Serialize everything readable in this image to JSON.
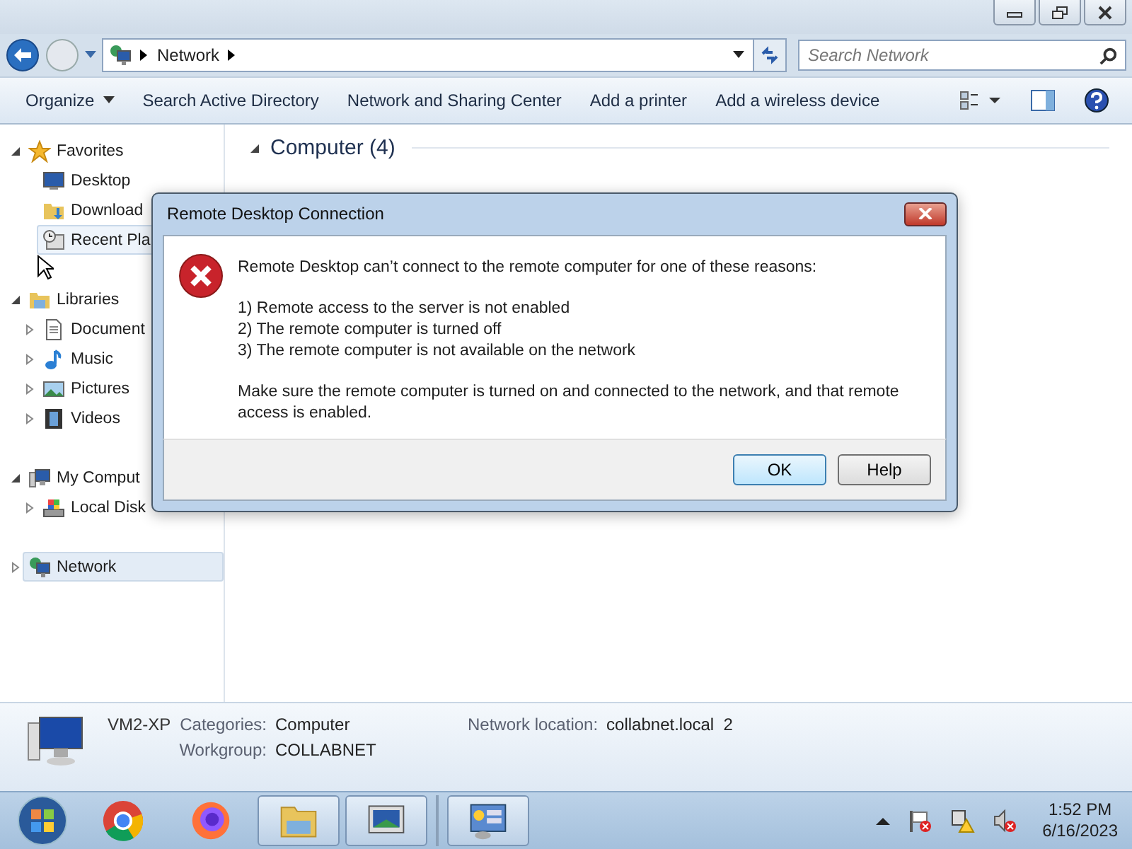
{
  "address": {
    "crumbs": [
      "Network"
    ]
  },
  "search": {
    "placeholder": "Search Network"
  },
  "toolbar": {
    "items": [
      {
        "label": "Organize",
        "dropdown": true
      },
      {
        "label": "Search Active Directory",
        "dropdown": false
      },
      {
        "label": "Network and Sharing Center",
        "dropdown": false
      },
      {
        "label": "Add a printer",
        "dropdown": false
      },
      {
        "label": "Add a wireless device",
        "dropdown": false
      }
    ]
  },
  "sidebar": {
    "items": [
      {
        "label": "Favorites",
        "kind": "star",
        "expanded": true,
        "selected": false,
        "hovered": false,
        "children": [
          {
            "label": "Desktop",
            "kind": "desktop",
            "selected": false,
            "hovered": false
          },
          {
            "label": "Download",
            "kind": "downloads",
            "selected": false,
            "hovered": false
          },
          {
            "label": "Recent Pla",
            "kind": "recent",
            "selected": false,
            "hovered": true
          }
        ]
      },
      {
        "label": "Libraries",
        "kind": "libraries",
        "expanded": true,
        "selected": false,
        "hovered": false,
        "children": [
          {
            "label": "Document",
            "kind": "documents",
            "expanded": false,
            "selected": false,
            "hovered": false
          },
          {
            "label": "Music",
            "kind": "music",
            "expanded": false,
            "selected": false,
            "hovered": false
          },
          {
            "label": "Pictures",
            "kind": "pictures",
            "expanded": false,
            "selected": false,
            "hovered": false
          },
          {
            "label": "Videos",
            "kind": "videos",
            "expanded": false,
            "selected": false,
            "hovered": false
          }
        ]
      },
      {
        "label": "My Comput",
        "kind": "computer",
        "expanded": true,
        "selected": false,
        "hovered": false,
        "children": [
          {
            "label": "Local Disk",
            "kind": "disk",
            "expanded": false,
            "selected": false,
            "hovered": false
          }
        ]
      },
      {
        "label": "Network",
        "kind": "network",
        "expanded": false,
        "selected": true,
        "hovered": false
      }
    ]
  },
  "content": {
    "group": "Computer (4)",
    "expanded": true
  },
  "dialog": {
    "title": "Remote Desktop Connection",
    "message": "Remote Desktop can’t connect to the remote computer for one of these reasons:",
    "reasons": [
      "1) Remote access to the server is not enabled",
      "2) The remote computer is turned off",
      "3) The remote computer is not available on the network"
    ],
    "advice": "Make sure the remote computer is turned on and connected to the network, and that remote access is enabled.",
    "buttons": [
      {
        "label": "OK",
        "default": true
      },
      {
        "label": "Help",
        "default": false
      }
    ]
  },
  "details": {
    "name": "VM2-XP",
    "fields": [
      {
        "label": "Categories:",
        "value": "Computer"
      },
      {
        "label": "Workgroup:",
        "value": "COLLABNET"
      },
      {
        "label": "Network location:",
        "value": "collabnet.local  2"
      }
    ]
  },
  "taskbar": {
    "apps": [
      {
        "kind": "chrome",
        "active": false
      },
      {
        "kind": "firefox",
        "active": false
      },
      {
        "kind": "explorer",
        "active": true
      },
      {
        "kind": "remote",
        "active": true
      },
      {
        "kind": "panel",
        "active": true
      }
    ],
    "time": "1:52 PM",
    "date": "6/16/2023"
  }
}
